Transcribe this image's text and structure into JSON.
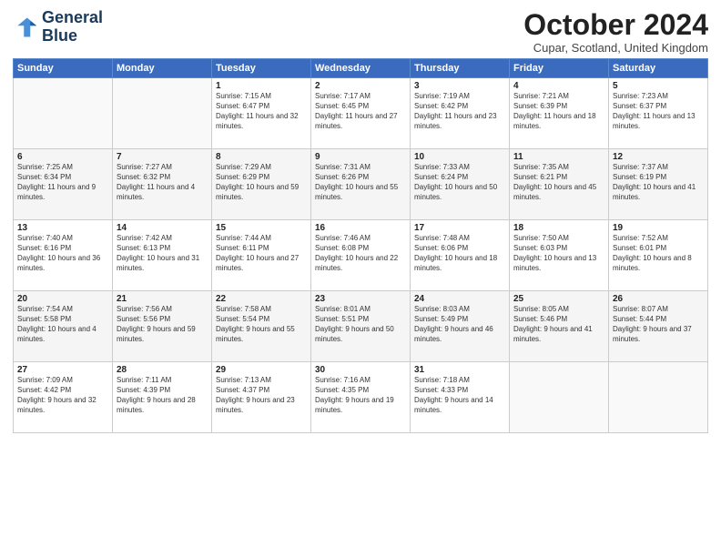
{
  "logo": {
    "line1": "General",
    "line2": "Blue"
  },
  "title": "October 2024",
  "location": "Cupar, Scotland, United Kingdom",
  "weekdays": [
    "Sunday",
    "Monday",
    "Tuesday",
    "Wednesday",
    "Thursday",
    "Friday",
    "Saturday"
  ],
  "weeks": [
    [
      {
        "day": "",
        "sunrise": "",
        "sunset": "",
        "daylight": ""
      },
      {
        "day": "",
        "sunrise": "",
        "sunset": "",
        "daylight": ""
      },
      {
        "day": "1",
        "sunrise": "Sunrise: 7:15 AM",
        "sunset": "Sunset: 6:47 PM",
        "daylight": "Daylight: 11 hours and 32 minutes."
      },
      {
        "day": "2",
        "sunrise": "Sunrise: 7:17 AM",
        "sunset": "Sunset: 6:45 PM",
        "daylight": "Daylight: 11 hours and 27 minutes."
      },
      {
        "day": "3",
        "sunrise": "Sunrise: 7:19 AM",
        "sunset": "Sunset: 6:42 PM",
        "daylight": "Daylight: 11 hours and 23 minutes."
      },
      {
        "day": "4",
        "sunrise": "Sunrise: 7:21 AM",
        "sunset": "Sunset: 6:39 PM",
        "daylight": "Daylight: 11 hours and 18 minutes."
      },
      {
        "day": "5",
        "sunrise": "Sunrise: 7:23 AM",
        "sunset": "Sunset: 6:37 PM",
        "daylight": "Daylight: 11 hours and 13 minutes."
      }
    ],
    [
      {
        "day": "6",
        "sunrise": "Sunrise: 7:25 AM",
        "sunset": "Sunset: 6:34 PM",
        "daylight": "Daylight: 11 hours and 9 minutes."
      },
      {
        "day": "7",
        "sunrise": "Sunrise: 7:27 AM",
        "sunset": "Sunset: 6:32 PM",
        "daylight": "Daylight: 11 hours and 4 minutes."
      },
      {
        "day": "8",
        "sunrise": "Sunrise: 7:29 AM",
        "sunset": "Sunset: 6:29 PM",
        "daylight": "Daylight: 10 hours and 59 minutes."
      },
      {
        "day": "9",
        "sunrise": "Sunrise: 7:31 AM",
        "sunset": "Sunset: 6:26 PM",
        "daylight": "Daylight: 10 hours and 55 minutes."
      },
      {
        "day": "10",
        "sunrise": "Sunrise: 7:33 AM",
        "sunset": "Sunset: 6:24 PM",
        "daylight": "Daylight: 10 hours and 50 minutes."
      },
      {
        "day": "11",
        "sunrise": "Sunrise: 7:35 AM",
        "sunset": "Sunset: 6:21 PM",
        "daylight": "Daylight: 10 hours and 45 minutes."
      },
      {
        "day": "12",
        "sunrise": "Sunrise: 7:37 AM",
        "sunset": "Sunset: 6:19 PM",
        "daylight": "Daylight: 10 hours and 41 minutes."
      }
    ],
    [
      {
        "day": "13",
        "sunrise": "Sunrise: 7:40 AM",
        "sunset": "Sunset: 6:16 PM",
        "daylight": "Daylight: 10 hours and 36 minutes."
      },
      {
        "day": "14",
        "sunrise": "Sunrise: 7:42 AM",
        "sunset": "Sunset: 6:13 PM",
        "daylight": "Daylight: 10 hours and 31 minutes."
      },
      {
        "day": "15",
        "sunrise": "Sunrise: 7:44 AM",
        "sunset": "Sunset: 6:11 PM",
        "daylight": "Daylight: 10 hours and 27 minutes."
      },
      {
        "day": "16",
        "sunrise": "Sunrise: 7:46 AM",
        "sunset": "Sunset: 6:08 PM",
        "daylight": "Daylight: 10 hours and 22 minutes."
      },
      {
        "day": "17",
        "sunrise": "Sunrise: 7:48 AM",
        "sunset": "Sunset: 6:06 PM",
        "daylight": "Daylight: 10 hours and 18 minutes."
      },
      {
        "day": "18",
        "sunrise": "Sunrise: 7:50 AM",
        "sunset": "Sunset: 6:03 PM",
        "daylight": "Daylight: 10 hours and 13 minutes."
      },
      {
        "day": "19",
        "sunrise": "Sunrise: 7:52 AM",
        "sunset": "Sunset: 6:01 PM",
        "daylight": "Daylight: 10 hours and 8 minutes."
      }
    ],
    [
      {
        "day": "20",
        "sunrise": "Sunrise: 7:54 AM",
        "sunset": "Sunset: 5:58 PM",
        "daylight": "Daylight: 10 hours and 4 minutes."
      },
      {
        "day": "21",
        "sunrise": "Sunrise: 7:56 AM",
        "sunset": "Sunset: 5:56 PM",
        "daylight": "Daylight: 9 hours and 59 minutes."
      },
      {
        "day": "22",
        "sunrise": "Sunrise: 7:58 AM",
        "sunset": "Sunset: 5:54 PM",
        "daylight": "Daylight: 9 hours and 55 minutes."
      },
      {
        "day": "23",
        "sunrise": "Sunrise: 8:01 AM",
        "sunset": "Sunset: 5:51 PM",
        "daylight": "Daylight: 9 hours and 50 minutes."
      },
      {
        "day": "24",
        "sunrise": "Sunrise: 8:03 AM",
        "sunset": "Sunset: 5:49 PM",
        "daylight": "Daylight: 9 hours and 46 minutes."
      },
      {
        "day": "25",
        "sunrise": "Sunrise: 8:05 AM",
        "sunset": "Sunset: 5:46 PM",
        "daylight": "Daylight: 9 hours and 41 minutes."
      },
      {
        "day": "26",
        "sunrise": "Sunrise: 8:07 AM",
        "sunset": "Sunset: 5:44 PM",
        "daylight": "Daylight: 9 hours and 37 minutes."
      }
    ],
    [
      {
        "day": "27",
        "sunrise": "Sunrise: 7:09 AM",
        "sunset": "Sunset: 4:42 PM",
        "daylight": "Daylight: 9 hours and 32 minutes."
      },
      {
        "day": "28",
        "sunrise": "Sunrise: 7:11 AM",
        "sunset": "Sunset: 4:39 PM",
        "daylight": "Daylight: 9 hours and 28 minutes."
      },
      {
        "day": "29",
        "sunrise": "Sunrise: 7:13 AM",
        "sunset": "Sunset: 4:37 PM",
        "daylight": "Daylight: 9 hours and 23 minutes."
      },
      {
        "day": "30",
        "sunrise": "Sunrise: 7:16 AM",
        "sunset": "Sunset: 4:35 PM",
        "daylight": "Daylight: 9 hours and 19 minutes."
      },
      {
        "day": "31",
        "sunrise": "Sunrise: 7:18 AM",
        "sunset": "Sunset: 4:33 PM",
        "daylight": "Daylight: 9 hours and 14 minutes."
      },
      {
        "day": "",
        "sunrise": "",
        "sunset": "",
        "daylight": ""
      },
      {
        "day": "",
        "sunrise": "",
        "sunset": "",
        "daylight": ""
      }
    ]
  ]
}
